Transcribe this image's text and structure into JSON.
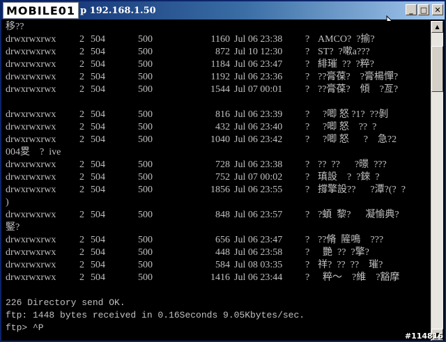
{
  "window": {
    "logo_text": "MOBILE01",
    "title": "p 192.168.1.50",
    "minimize_glyph": "_",
    "maximize_glyph": "□",
    "close_glyph": "✕"
  },
  "console": {
    "first_line": "移??",
    "rows": [
      {
        "perm": "drwxrwxrwx",
        "links": "2",
        "owner": "504",
        "group": "500",
        "size": "1160",
        "date": "Jul 06 23:38",
        "q": "?",
        "name": "AMCO?  ?揄?",
        "cont": ""
      },
      {
        "perm": "drwxrwxrwx",
        "links": "2",
        "owner": "504",
        "group": "500",
        "size": "872",
        "date": "Jul 10 12:30",
        "q": "?",
        "name": "ST?  ?嗽a???",
        "cont": ""
      },
      {
        "perm": "drwxrwxrwx",
        "links": "2",
        "owner": "504",
        "group": "500",
        "size": "1184",
        "date": "Jul 06 23:47",
        "q": "?",
        "name": "緋璀  ??  ?粹?",
        "cont": ""
      },
      {
        "perm": "drwxrwxrwx",
        "links": "2",
        "owner": "504",
        "group": "500",
        "size": "1192",
        "date": "Jul 06 23:36",
        "q": "?",
        "name": "??膏葆?    ?膏楊憚?",
        "cont": ""
      },
      {
        "perm": "drwxrwxrwx",
        "links": "2",
        "owner": "504",
        "group": "500",
        "size": "1544",
        "date": "Jul 07 00:01",
        "q": "?",
        "name": "??膏葆?    傾    ?亙?",
        "cont": ""
      },
      {
        "blank": true
      },
      {
        "perm": "drwxrwxrwx",
        "links": "2",
        "owner": "504",
        "group": "500",
        "size": "816",
        "date": "Jul 06 23:39",
        "q": "?",
        "name": "  ?唧 怒 ?1?  ??剝",
        "cont": ""
      },
      {
        "perm": "drwxrwxrwx",
        "links": "2",
        "owner": "504",
        "group": "500",
        "size": "432",
        "date": "Jul 06 23:40",
        "q": "?",
        "name": "  ?唧 怒    ??  ?",
        "cont": ""
      },
      {
        "perm": "drwxrwxrwx",
        "links": "2",
        "owner": "504",
        "group": "500",
        "size": "1040",
        "date": "Jul 06 23:42",
        "q": "?",
        "name": "  ?唧 怒      ?    急?2",
        "cont": "004畟    ?  ive"
      },
      {
        "perm": "drwxrwxrwx",
        "links": "2",
        "owner": "504",
        "group": "500",
        "size": "728",
        "date": "Jul 06 23:38",
        "q": "?",
        "name": "??  ??      ?暻  ???",
        "cont": ""
      },
      {
        "perm": "drwxrwxrwx",
        "links": "2",
        "owner": "504",
        "group": "500",
        "size": "752",
        "date": "Jul 07 00:02",
        "q": "?",
        "name": "瑱設    ?  ?錸  ?",
        "cont": ""
      },
      {
        "perm": "drwxrwxrwx",
        "links": "2",
        "owner": "504",
        "group": "500",
        "size": "1856",
        "date": "Jul 06 23:55",
        "q": "?",
        "name": "撐擎設??      ?潭?(?  ?",
        "cont": ")"
      },
      {
        "perm": "drwxrwxrwx",
        "links": "2",
        "owner": "504",
        "group": "500",
        "size": "848",
        "date": "Jul 06 23:57",
        "q": "?",
        "name": "?蝢  黎?      凝愉典?",
        "cont": "鋻?"
      },
      {
        "perm": "drwxrwxrwx",
        "links": "2",
        "owner": "504",
        "group": "500",
        "size": "656",
        "date": "Jul 06 23:47",
        "q": "?",
        "name": "??脩  隡鳴    ???",
        "cont": ""
      },
      {
        "perm": "drwxrwxrwx",
        "links": "2",
        "owner": "504",
        "group": "500",
        "size": "448",
        "date": "Jul 06 23:58",
        "q": "?",
        "name": "  艷  ??  ?擎?",
        "cont": ""
      },
      {
        "perm": "drwxrwxrwx",
        "links": "2",
        "owner": "504",
        "group": "500",
        "size": "584",
        "date": "Jul 08 03:35",
        "q": "?",
        "name": "祥?  ??  ??    璀?",
        "cont": ""
      },
      {
        "perm": "drwxrwxrwx",
        "links": "2",
        "owner": "504",
        "group": "500",
        "size": "1416",
        "date": "Jul 06 23:44",
        "q": "?",
        "name": "  粹～    ?維    ?豁摩",
        "cont": ""
      },
      {
        "blank": true
      }
    ],
    "status_ok": "226 Directory send OK.",
    "status_bytes": "ftp: 1448 bytes received in 0.16Seconds 9.05Kbytes/sec.",
    "prompt": "ftp> ^P"
  },
  "watermark": "#114816"
}
